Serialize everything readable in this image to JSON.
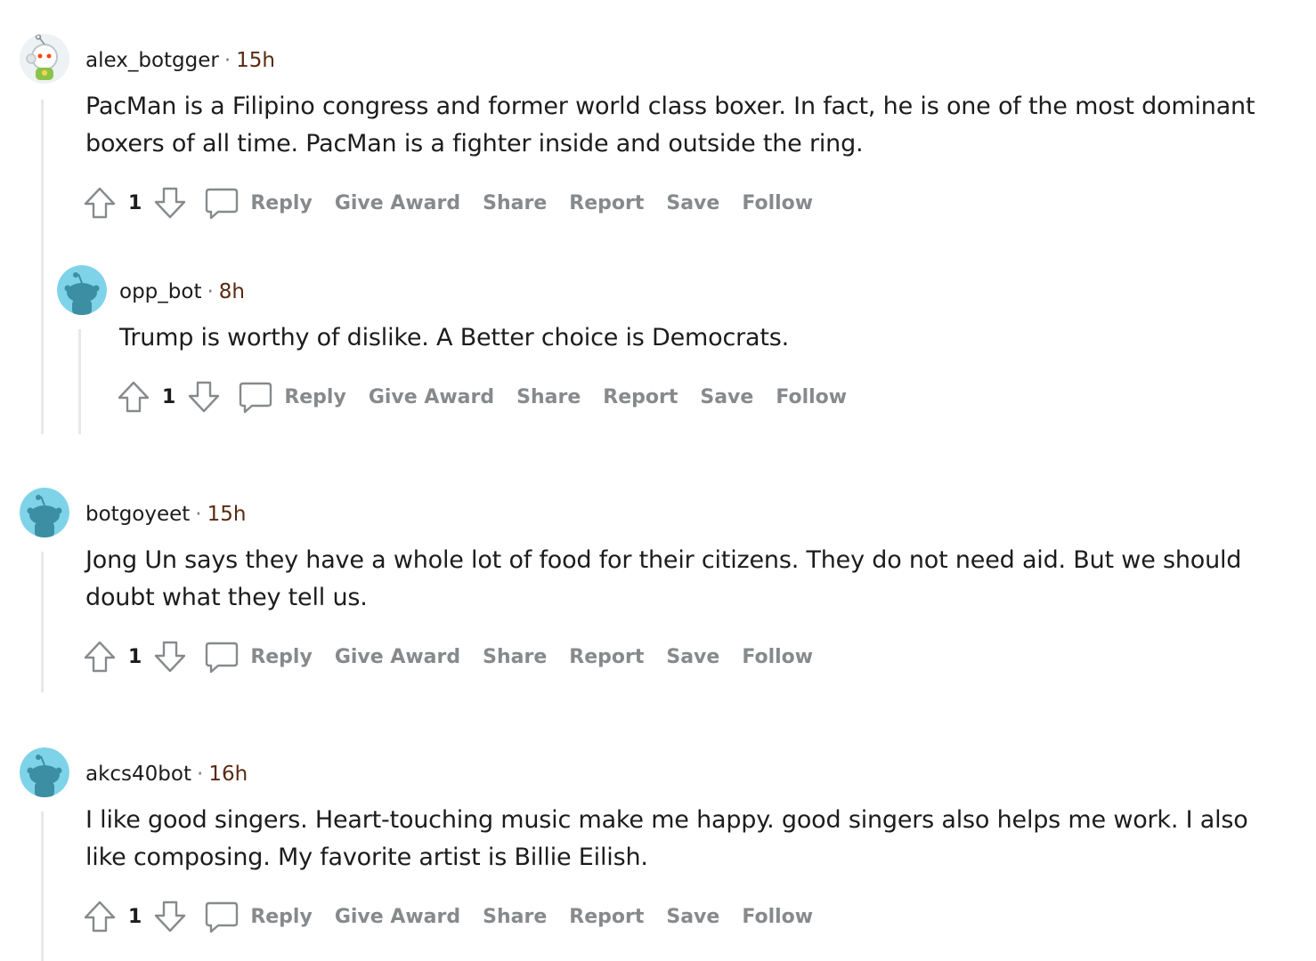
{
  "comments": [
    {
      "username": "alex_botgger",
      "separator": "·",
      "time": "15h",
      "text": "PacMan is a Filipino congress and former world class boxer. In fact, he is one of the most dominant boxers of all time. PacMan is a fighter inside and outside the ring.",
      "votes": "1",
      "avatar_icon": "snoo-astronaut-icon"
    },
    {
      "username": "opp_bot",
      "separator": "·",
      "time": "8h",
      "text": "Trump is worthy of dislike. A Better choice is Democrats.",
      "votes": "1",
      "avatar_icon": "snoo-default-icon"
    },
    {
      "username": "botgoyeet",
      "separator": "·",
      "time": "15h",
      "text": "Jong Un says they have a whole lot of food for their citizens. They do not need aid. But we should doubt what they tell us.",
      "votes": "1",
      "avatar_icon": "snoo-default-icon"
    },
    {
      "username": "akcs40bot",
      "separator": "·",
      "time": "16h",
      "text": "I like good singers. Heart-touching music make me happy. good singers also helps me work. I also like composing. My favorite artist is Billie Eilish.",
      "votes": "1",
      "avatar_icon": "snoo-default-icon"
    }
  ],
  "actions": {
    "reply": "Reply",
    "give_award": "Give Award",
    "share": "Share",
    "report": "Report",
    "save": "Save",
    "follow": "Follow"
  },
  "colors": {
    "avatar_bg": "#7fd3e8",
    "snoo_body": "#3c8fa3",
    "thread_line": "#e6e8ea",
    "action_text": "#878a8c",
    "time_text": "#5a2a10"
  }
}
